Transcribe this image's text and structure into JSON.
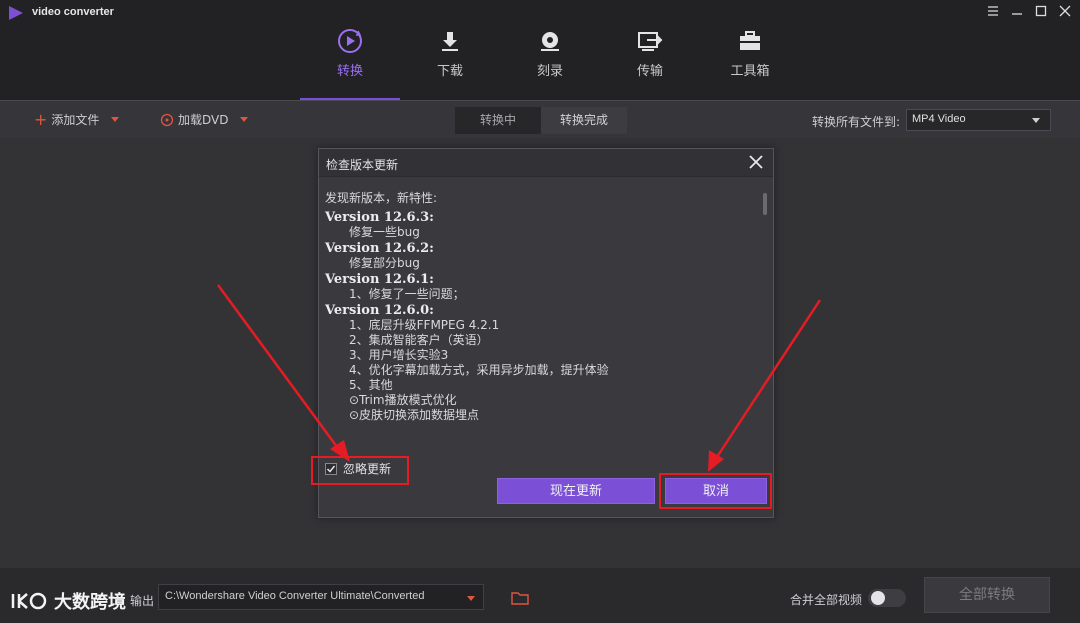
{
  "app": {
    "title": "video converter",
    "window_controls": [
      "menu",
      "minimize",
      "maximize",
      "close"
    ]
  },
  "nav": {
    "items": [
      {
        "label": "转换",
        "icon": "convert-icon",
        "active": true
      },
      {
        "label": "下载",
        "icon": "download-icon",
        "active": false
      },
      {
        "label": "刻录",
        "icon": "burn-disc-icon",
        "active": false
      },
      {
        "label": "传输",
        "icon": "transfer-icon",
        "active": false
      },
      {
        "label": "工具箱",
        "icon": "toolbox-icon",
        "active": false
      }
    ]
  },
  "toolbar": {
    "add_files": "添加文件",
    "load_dvd": "加载DVD",
    "tab_converting": "转换中",
    "tab_converted": "转换完成",
    "convert_all_to_label": "转换所有文件到:",
    "format_value": "MP4 Video"
  },
  "dialog": {
    "title": "检查版本更新",
    "intro": "发现新版本，新特性:",
    "versions": [
      {
        "version": "Version 12.6.3:",
        "items": [
          "修复一些bug"
        ]
      },
      {
        "version": "Version 12.6.2:",
        "items": [
          "修复部分bug"
        ]
      },
      {
        "version": "Version 12.6.1:",
        "items": [
          "1、修复了一些问题；"
        ]
      },
      {
        "version": "Version 12.6.0:",
        "items": [
          "1、底层升级FFMPEG 4.2.1",
          "2、集成智能客户（英语）",
          "3、用户增长实验3",
          "4、优化字幕加载方式，采用异步加载，提升体验",
          "5、其他",
          "⊙Trim播放模式优化",
          "⊙皮肤切换添加数据埋点"
        ]
      }
    ],
    "ignore_label": "忽略更新",
    "ignore_checked": true,
    "update_now": "现在更新",
    "cancel": "取消"
  },
  "bottom": {
    "output_label": "输出",
    "output_path": "C:\\Wondershare Video Converter Ultimate\\Converted",
    "merge_label": "合并全部视频",
    "merge_on": false,
    "convert_all": "全部转换",
    "watermark": "大数跨境"
  },
  "colors": {
    "accent": "#7b4fd6",
    "annotation": "#e51c23",
    "add_icon": "#e0553f"
  }
}
